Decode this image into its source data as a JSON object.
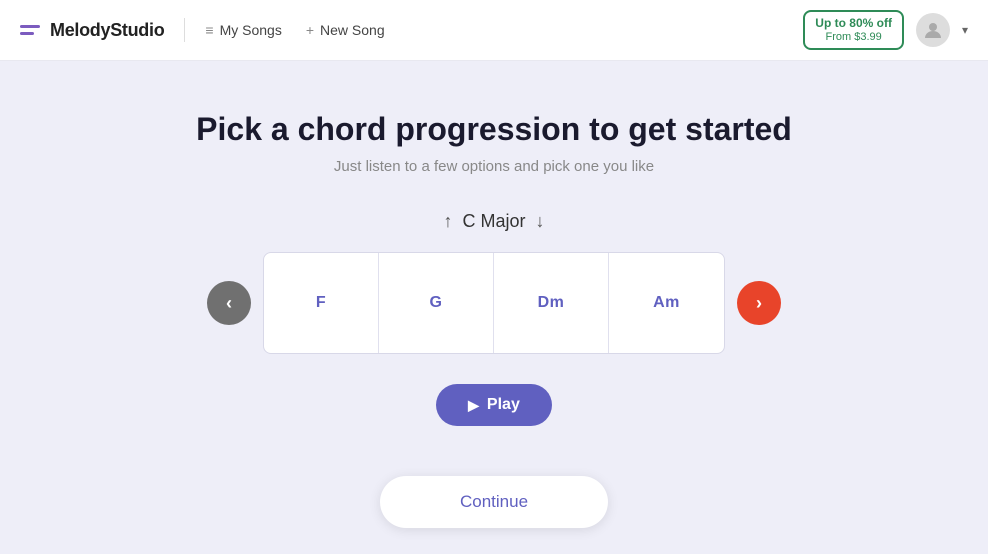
{
  "navbar": {
    "logo_title": "MelodyStudio",
    "my_songs_label": "My Songs",
    "new_song_label": "New Song",
    "promo_top": "Up to 80% off",
    "promo_bottom": "From $3.99"
  },
  "main": {
    "title": "Pick a chord progression to get started",
    "subtitle": "Just listen to a few options and pick one you like",
    "key_label": "C  Major",
    "chords": [
      {
        "name": "F"
      },
      {
        "name": "G"
      },
      {
        "name": "Dm"
      },
      {
        "name": "Am"
      }
    ],
    "play_label": "Play",
    "continue_label": "Continue"
  }
}
